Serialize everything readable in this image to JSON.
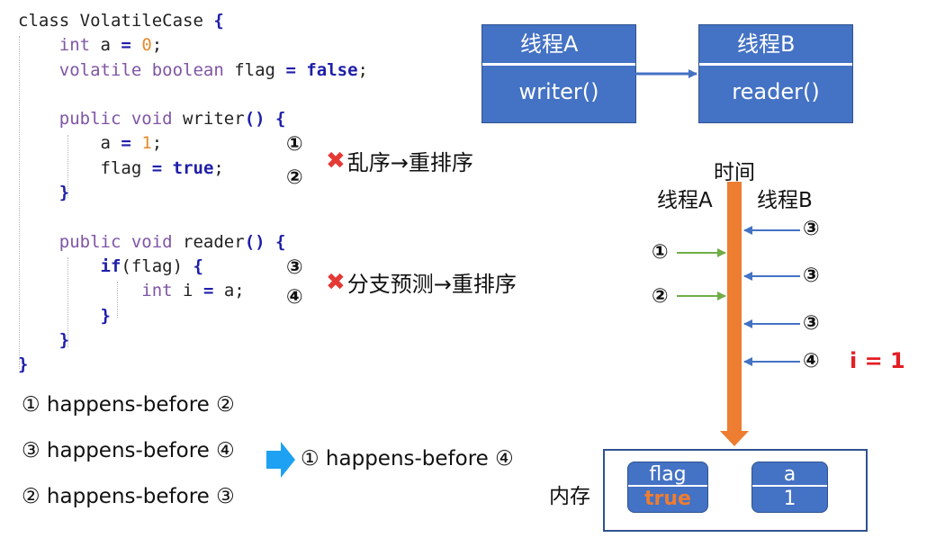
{
  "code": {
    "l1": [
      "class VolatileCase ",
      "{"
    ],
    "l2": [
      "int",
      " a ",
      "=",
      " ",
      "0",
      ";"
    ],
    "l3": [
      "volatile boolean",
      " flag ",
      "=",
      " ",
      "false",
      ";"
    ],
    "l4": [
      "public void",
      " writer",
      "()",
      " ",
      "{"
    ],
    "l5": [
      "a ",
      "=",
      " ",
      "1",
      ";"
    ],
    "l6": [
      "flag ",
      "=",
      " ",
      "true",
      ";"
    ],
    "l7": [
      "}"
    ],
    "l8": [
      "public void",
      " reader",
      "()",
      " ",
      "{"
    ],
    "l9": [
      "if",
      "(flag) ",
      "{"
    ],
    "l10": [
      "int",
      " i ",
      "=",
      " a;"
    ],
    "l11": [
      "}"
    ],
    "l12": [
      "}"
    ],
    "l13": [
      "}"
    ]
  },
  "markers": {
    "m1": "①",
    "m2": "②",
    "m3": "③",
    "m4": "④"
  },
  "notes": {
    "reorder1_icon": "✖",
    "reorder1": "乱序→重排序",
    "reorder2_icon": "✖",
    "reorder2": "分支预测→重排序"
  },
  "hb": {
    "r1": "① happens-before ②",
    "r2": "③ happens-before ④",
    "r3": "② happens-before ③",
    "result": "① happens-before ④"
  },
  "threads": {
    "a_title": "线程A",
    "a_method": "writer()",
    "b_title": "线程B",
    "b_method": "reader()"
  },
  "timeline": {
    "title": "时间",
    "left": "线程A",
    "right": "线程B",
    "p1": "①",
    "p2": "②",
    "q1": "③",
    "q2": "③",
    "q3": "③",
    "q4": "④",
    "result": "i = 1"
  },
  "memory": {
    "label": "内存",
    "flag_name": "flag",
    "flag_value": "true",
    "a_name": "a",
    "a_value": "1"
  },
  "colors": {
    "box": "#4472c4",
    "timeline": "#ed7d31",
    "arrow_a": "#70ad47",
    "arrow_b": "#4472c4",
    "result": "#e31e24",
    "value_true": "#ed7d31",
    "cross": "#e53935",
    "implies": "#1ea1f2"
  }
}
